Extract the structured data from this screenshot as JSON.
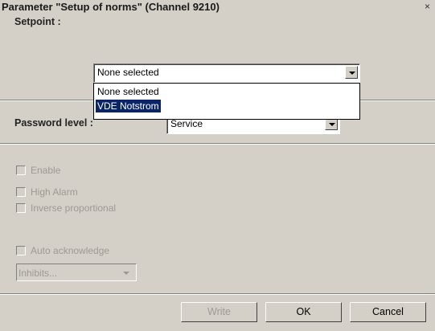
{
  "window": {
    "title": "Parameter \"Setup of norms\" (Channel 9210)",
    "close_glyph": "×"
  },
  "setpoint": {
    "label": "Setpoint :",
    "selected": "None selected",
    "options": [
      "None selected",
      "VDE Notstrom"
    ]
  },
  "password": {
    "label": "Password level :",
    "value": "Service"
  },
  "checkboxes": {
    "enable": "Enable",
    "high_alarm": "High Alarm",
    "inverse_proportional": "Inverse proportional",
    "auto_acknowledge": "Auto acknowledge"
  },
  "inhibits": {
    "value": "Inhibits..."
  },
  "buttons": {
    "write": "Write",
    "ok": "OK",
    "cancel": "Cancel"
  }
}
